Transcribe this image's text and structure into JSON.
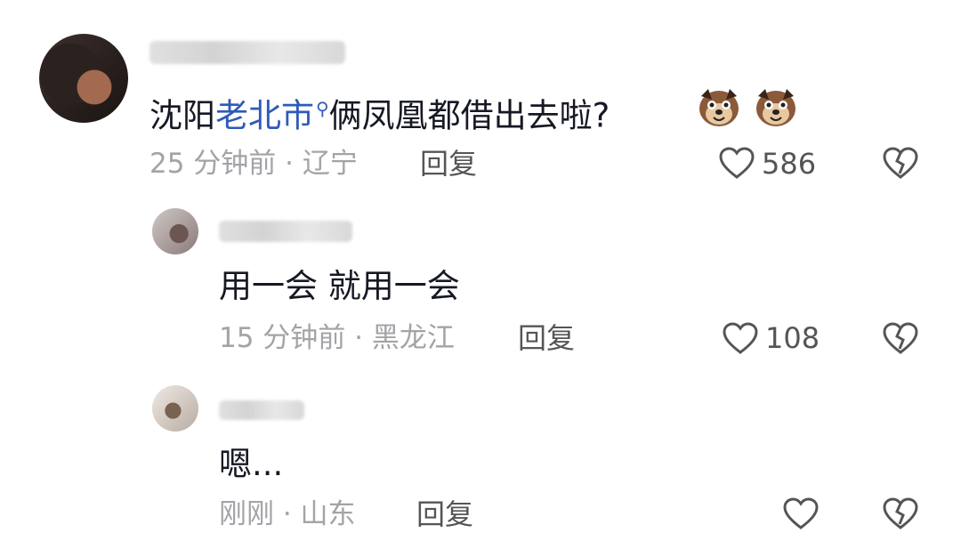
{
  "comments": [
    {
      "text_before": "沈阳",
      "link_text": "老北市",
      "text_after": "俩凤凰都借出去啦?",
      "emojis": [
        "dog-emoji",
        "dog-emoji"
      ],
      "time": "25 分钟前 · 辽宁",
      "reply_label": "回复",
      "likes": "586"
    },
    {
      "text": "用一会 就用一会",
      "time": "15 分钟前 · 黑龙江",
      "reply_label": "回复",
      "likes": "108"
    },
    {
      "text": "嗯...",
      "time": "刚刚 · 山东",
      "reply_label": "回复",
      "likes": ""
    }
  ],
  "icons": {
    "like": "heart-icon",
    "dislike": "broken-heart-icon",
    "search": "search-icon"
  },
  "colors": {
    "link": "#2d5bb7",
    "meta": "#a3a3a8"
  }
}
